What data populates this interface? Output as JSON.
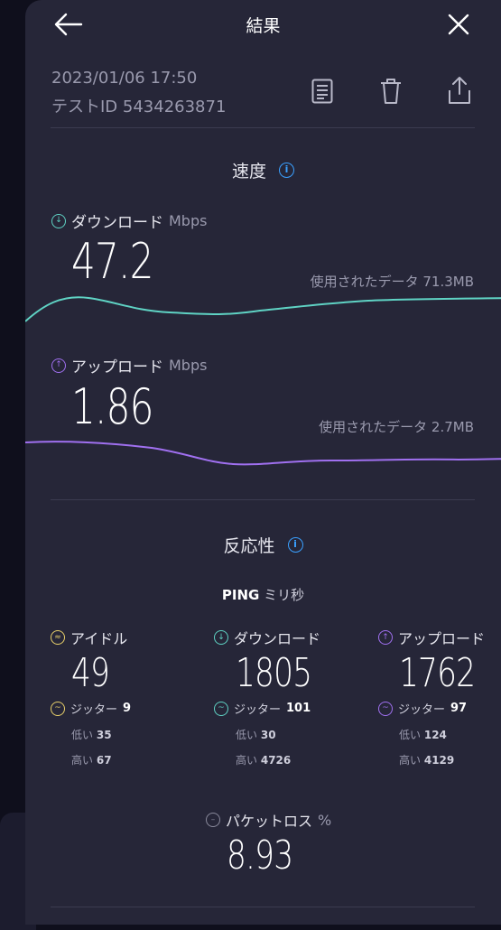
{
  "header": {
    "title": "結果"
  },
  "meta": {
    "datetime": "2023/01/06 17:50",
    "test_id": "テストID 5434263871"
  },
  "icons": {
    "back": "arrow-left-icon",
    "close": "close-icon",
    "notes": "document-icon",
    "delete": "trash-icon",
    "share": "share-icon"
  },
  "speed": {
    "section_title": "速度",
    "download": {
      "label": "ダウンロード",
      "unit": "Mbps",
      "value": "47.2",
      "used": "使用されたデータ 71.3MB",
      "color": "#5fd3c4"
    },
    "upload": {
      "label": "アップロード",
      "unit": "Mbps",
      "value": "1.86",
      "used": "使用されたデータ 2.7MB",
      "color": "#a070f0"
    }
  },
  "responsiveness": {
    "section_title": "反応性",
    "ping_label": "PING",
    "ping_unit": "ミリ秒",
    "columns": [
      {
        "label": "アイドル",
        "value": "49",
        "jitter_label": "ジッター",
        "jitter": "9",
        "low_label": "低い",
        "low": "35",
        "high_label": "高い",
        "high": "67",
        "color": "#e8d06a"
      },
      {
        "label": "ダウンロード",
        "value": "1805",
        "jitter_label": "ジッター",
        "jitter": "101",
        "low_label": "低い",
        "low": "30",
        "high_label": "高い",
        "high": "4726",
        "color": "#5fd3c4"
      },
      {
        "label": "アップロード",
        "value": "1762",
        "jitter_label": "ジッター",
        "jitter": "97",
        "low_label": "低い",
        "low": "124",
        "high_label": "高い",
        "high": "4129",
        "color": "#a070f0"
      }
    ],
    "packet_loss": {
      "label": "パケットロス",
      "unit": "%",
      "value": "8.93"
    }
  }
}
